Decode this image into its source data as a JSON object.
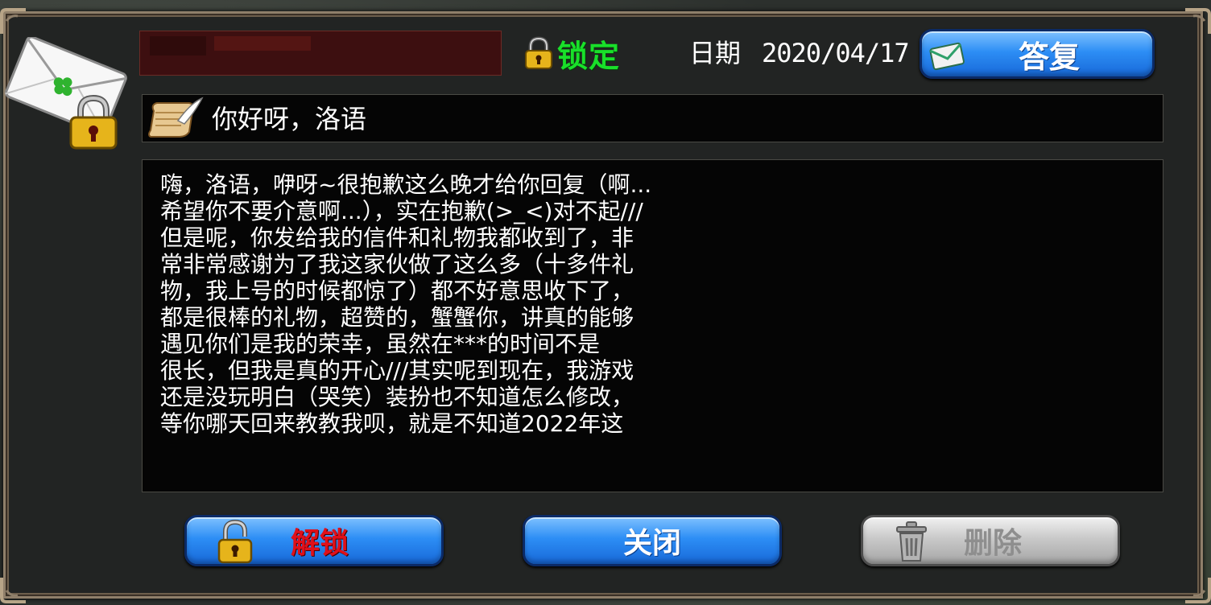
{
  "header": {
    "lock_status": "锁定",
    "date_label": "日期",
    "date_value": "2020/04/17",
    "reply_label": "答复"
  },
  "subject": "你好呀，洛语",
  "body_lines": [
    "嗨，洛语，咿呀~很抱歉这么晚才给你回复（啊...",
    "希望你不要介意啊...），实在抱歉(>_<)对不起///",
    "但是呢，你发给我的信件和礼物我都收到了，非",
    "常非常感谢为了我这家伙做了这么多（十多件礼",
    "物，我上号的时候都惊了）都不好意思收下了，",
    "都是很棒的礼物，超赞的，蟹蟹你，讲真的能够",
    "遇见你们是我的荣幸，虽然在***的时间不是",
    "很长，但我是真的开心///其实呢到现在，我游戏",
    "还是没玩明白（哭笑）装扮也不知道怎么修改，",
    "等你哪天回来教教我呗，就是不知道2022年这"
  ],
  "buttons": {
    "unlock": "解锁",
    "close": "关闭",
    "delete": "删除"
  },
  "colors": {
    "lock_status": "#19e02a",
    "unlock_text": "#e0101a",
    "button_blue": "#2d8ef5",
    "sender_box": "#3d0f10"
  },
  "icons": {
    "mail": "locked-envelope-icon",
    "lock": "padlock-icon",
    "reply": "envelope-icon",
    "subject": "scroll-quill-icon",
    "delete": "trash-icon"
  }
}
